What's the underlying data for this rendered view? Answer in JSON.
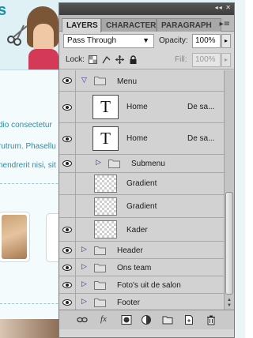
{
  "background": {
    "logo_fragment": "s",
    "text_lines": [
      "dio consectetur",
      "rutrum. Phasellu",
      "nendrerit nisi, sit"
    ]
  },
  "panel": {
    "tabs": [
      {
        "label": "LAYERS",
        "active": true
      },
      {
        "label": "CHARACTER",
        "active": false
      },
      {
        "label": "PARAGRAPH",
        "active": false
      }
    ],
    "blend_mode": "Pass Through",
    "opacity_label": "Opacity:",
    "opacity_value": "100%",
    "lock_label": "Lock:",
    "fill_label": "Fill:",
    "fill_value": "100%",
    "layers": [
      {
        "name": "Menu",
        "kind": "group",
        "expanded": true,
        "visible": true
      },
      {
        "name": "Home",
        "kind": "text",
        "extra": "De sa...",
        "visible": true
      },
      {
        "name": "Home",
        "kind": "text",
        "extra": "De sa...",
        "visible": true
      },
      {
        "name": "Submenu",
        "kind": "group",
        "expanded": false,
        "visible": true
      },
      {
        "name": "Gradient",
        "kind": "pixel",
        "visible": false
      },
      {
        "name": "Gradient",
        "kind": "pixel",
        "visible": false
      },
      {
        "name": "Kader",
        "kind": "pixel",
        "visible": true
      },
      {
        "name": "Header",
        "kind": "group",
        "expanded": false,
        "visible": true
      },
      {
        "name": "Ons team",
        "kind": "group",
        "expanded": false,
        "visible": true
      },
      {
        "name": "Foto's uit de salon",
        "kind": "group",
        "expanded": false,
        "visible": true
      },
      {
        "name": "Footer",
        "kind": "group",
        "expanded": false,
        "visible": true
      }
    ],
    "text_thumb_glyph": "T",
    "bottom_icons": [
      "link-icon",
      "fx-icon",
      "mask-icon",
      "adjustment-icon",
      "new-group-icon",
      "new-layer-icon",
      "trash-icon"
    ],
    "fx_label": "fx"
  }
}
